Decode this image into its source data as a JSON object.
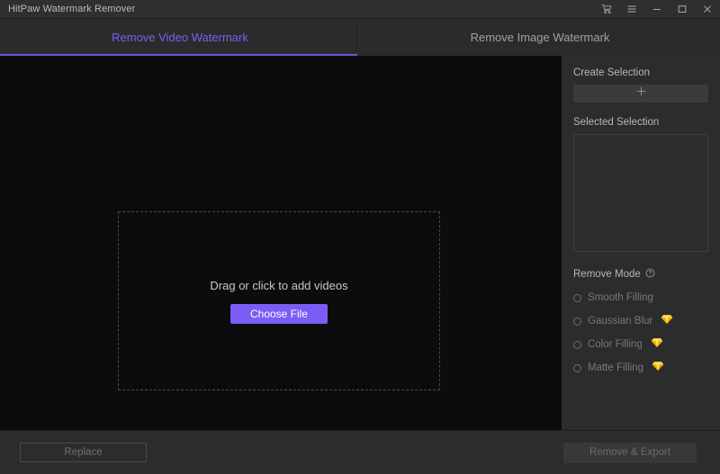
{
  "window": {
    "title": "HitPaw Watermark Remover",
    "controls": [
      {
        "name": "cart-icon",
        "label": "Store"
      },
      {
        "name": "menu-icon",
        "label": "Menu"
      },
      {
        "name": "minimize-icon",
        "label": "Minimize"
      },
      {
        "name": "maximize-icon",
        "label": "Maximize"
      },
      {
        "name": "close-icon",
        "label": "Close"
      }
    ]
  },
  "tabs": [
    {
      "label": "Remove Video Watermark",
      "active": true
    },
    {
      "label": "Remove Image Watermark",
      "active": false
    }
  ],
  "stage": {
    "drop_text": "Drag or click to add videos",
    "choose_file_label": "Choose File"
  },
  "panel": {
    "create_selection_label": "Create Selection",
    "create_selection_button": "+",
    "selected_selection_label": "Selected Selection",
    "selected_selection_items": [],
    "remove_mode_label": "Remove Mode",
    "remove_mode_help": "?",
    "modes": [
      {
        "label": "Smooth Filling",
        "selected": false,
        "premium": false
      },
      {
        "label": "Gaussian Blur",
        "selected": false,
        "premium": true
      },
      {
        "label": "Color Filling",
        "selected": false,
        "premium": true
      },
      {
        "label": "Matte Filling",
        "selected": false,
        "premium": true
      }
    ]
  },
  "bottom": {
    "replace_label": "Replace",
    "export_label": "Remove & Export"
  },
  "colors": {
    "accent_purple": "#7b5cf5",
    "tab_active_text": "#7b61e8",
    "premium_gold": "#f2b90c",
    "stage_bg": "#0c0c0e",
    "panel_bg": "#2b2c2e"
  }
}
